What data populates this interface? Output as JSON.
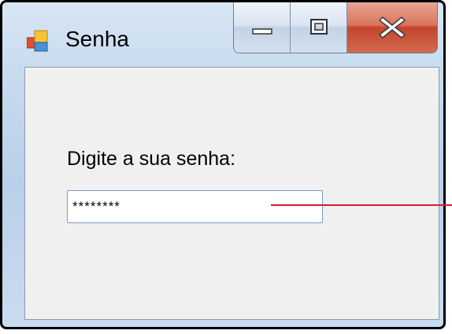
{
  "window": {
    "title": "Senha",
    "icon": "application-icon",
    "controls": {
      "minimize_icon": "minimize-icon",
      "maximize_icon": "maximize-icon",
      "close_icon": "close-icon"
    }
  },
  "form": {
    "prompt_label": "Digite a sua senha:",
    "password_value": "********"
  },
  "colors": {
    "annotation_line": "#d0202a",
    "close_button": "#c4452b",
    "client_background": "#f0f0f0"
  }
}
